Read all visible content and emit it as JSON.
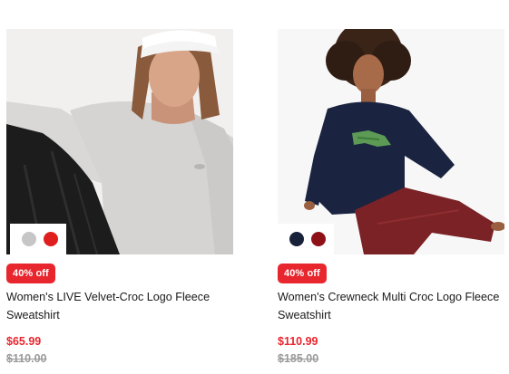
{
  "products": [
    {
      "image_alt": "Woman in light grey sweatshirt and white cap",
      "swatch_colors": [
        "#c6c6c6",
        "#e01e1e"
      ],
      "discount_label": "40% off",
      "title": "Women's LIVE Velvet-Croc Logo Fleece Sweatshirt",
      "price": "$65.99",
      "original_price": "$110.00"
    },
    {
      "image_alt": "Woman in navy sweatshirt with green croc logo and burgundy pants",
      "swatch_colors": [
        "#17223a",
        "#8e1118"
      ],
      "discount_label": "40% off",
      "title": "Women's Crewneck Multi Croc Logo Fleece Sweatshirt",
      "price": "$110.99",
      "original_price": "$185.00"
    }
  ],
  "colors": {
    "sale_red": "#e8262e",
    "strike_grey": "#9a9a9a",
    "text": "#1a1a1a"
  }
}
